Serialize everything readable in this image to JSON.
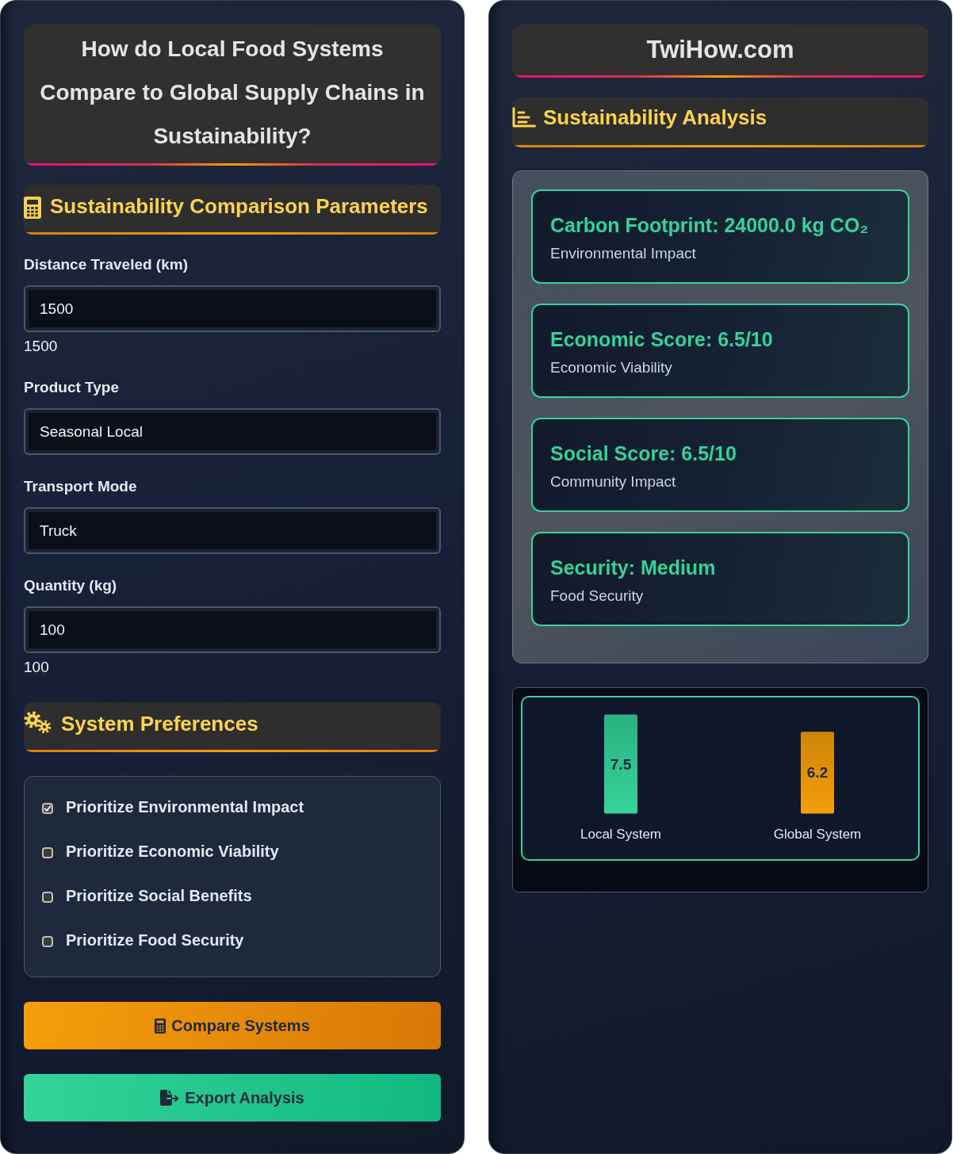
{
  "left_panel": {
    "title": "How do Local Food Systems Compare to Global Supply Chains in Sustainability?",
    "parameters_header": {
      "title": "Sustainability Comparison Parameters"
    },
    "fields": [
      {
        "label": "Distance Traveled (km)",
        "value": "1500",
        "readout": "1500"
      },
      {
        "label": "Product Type",
        "value": "Seasonal Local"
      },
      {
        "label": "Transport Mode",
        "value": "Truck"
      },
      {
        "label": "Quantity (kg)",
        "value": "100",
        "readout": "100"
      }
    ],
    "preferences_header": {
      "title": "System Preferences"
    },
    "preferences": [
      {
        "label": "Prioritize Environmental Impact",
        "checked": true
      },
      {
        "label": "Prioritize Economic Viability",
        "checked": false
      },
      {
        "label": "Prioritize Social Benefits",
        "checked": false
      },
      {
        "label": "Prioritize Food Security",
        "checked": false
      }
    ],
    "buttons": [
      {
        "kind": "compare",
        "label": "Compare Systems"
      },
      {
        "kind": "export",
        "label": "Export Analysis"
      }
    ]
  },
  "right_panel": {
    "brand": "TwiHow.com",
    "analysis_header": {
      "title": "Sustainability Analysis"
    },
    "results": [
      {
        "title": "Carbon Footprint: 24000.0 kg CO₂",
        "caption": "Environmental Impact"
      },
      {
        "title": "Economic Score: 6.5/10",
        "caption": "Economic Viability"
      },
      {
        "title": "Social Score: 6.5/10",
        "caption": "Community Impact"
      },
      {
        "title": "Security: Medium",
        "caption": "Food Security"
      }
    ],
    "chart_data": {
      "type": "bar",
      "categories": [
        "Local System",
        "Global System"
      ],
      "series": [
        {
          "color": "#34d399",
          "values": [
            7.5,
            null
          ]
        },
        {
          "color": "#f59e0b",
          "values": [
            null,
            6.2
          ]
        }
      ],
      "data_labels": true
    }
  }
}
